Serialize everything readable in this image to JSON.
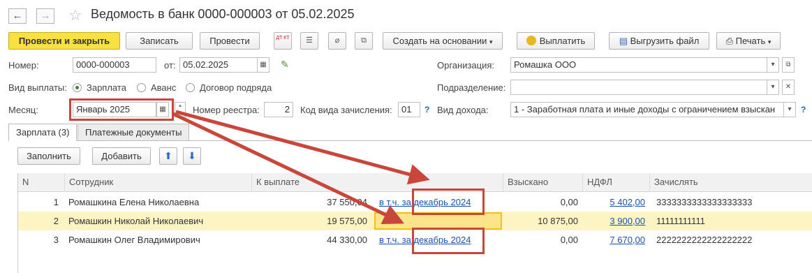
{
  "window": {
    "title": "Ведомость в банк 0000-000003 от 05.02.2025"
  },
  "toolbar": {
    "post_close": "Провести и закрыть",
    "save": "Записать",
    "post": "Провести",
    "dt_kt_label": "ДТ КТ",
    "create_based": "Создать на основании",
    "pay": "Выплатить",
    "export": "Выгрузить файл",
    "print": "Печать"
  },
  "form": {
    "number_label": "Номер:",
    "number_value": "0000-000003",
    "date_label": "от:",
    "date_value": "05.02.2025",
    "org_label": "Организация:",
    "org_value": "Ромашка ООО",
    "pay_type_label": "Вид выплаты:",
    "pay_options": [
      "Зарплата",
      "Аванс",
      "Договор подряда"
    ],
    "dept_label": "Подразделение:",
    "dept_value": "",
    "month_label": "Месяц:",
    "month_value": "Январь 2025",
    "registry_label": "Номер реестра:",
    "registry_value": "2",
    "credit_code_label": "Код вида зачисления:",
    "credit_code_value": "01",
    "income_label": "Вид дохода:",
    "income_value": "1 - Заработная плата и иные доходы с ограничением взыскан"
  },
  "tabs": [
    "Зарплата (3)",
    "Платежные документы"
  ],
  "table_toolbar": {
    "fill": "Заполнить",
    "add": "Добавить"
  },
  "table": {
    "headers": [
      "N",
      "Сотрудник",
      "К выплате",
      "Взыскано",
      "НДФЛ",
      "Зачислять"
    ],
    "rows": [
      {
        "n": "1",
        "employee": "Ромашкина Елена Николаевна",
        "amount": "37 550,04",
        "note": "в т.ч. за декабрь 2024",
        "withheld": "0,00",
        "ndfl": "5 402,00",
        "account": "3333333333333333333"
      },
      {
        "n": "2",
        "employee": "Ромашкин Николай Николаевич",
        "amount": "19 575,00",
        "note": "",
        "withheld": "10 875,00",
        "ndfl": "3 900,00",
        "account": "11111111111"
      },
      {
        "n": "3",
        "employee": "Ромашкин Олег Владимирович",
        "amount": "44 330,00",
        "note": "в т.ч. за декабрь 2024",
        "withheld": "0,00",
        "ndfl": "7 670,00",
        "account": "2222222222222222222"
      }
    ]
  },
  "colors": {
    "primary_button": "#f8e040",
    "highlight": "#c9473a",
    "selected_row": "#fdf4c4",
    "link": "#1a52b0"
  }
}
